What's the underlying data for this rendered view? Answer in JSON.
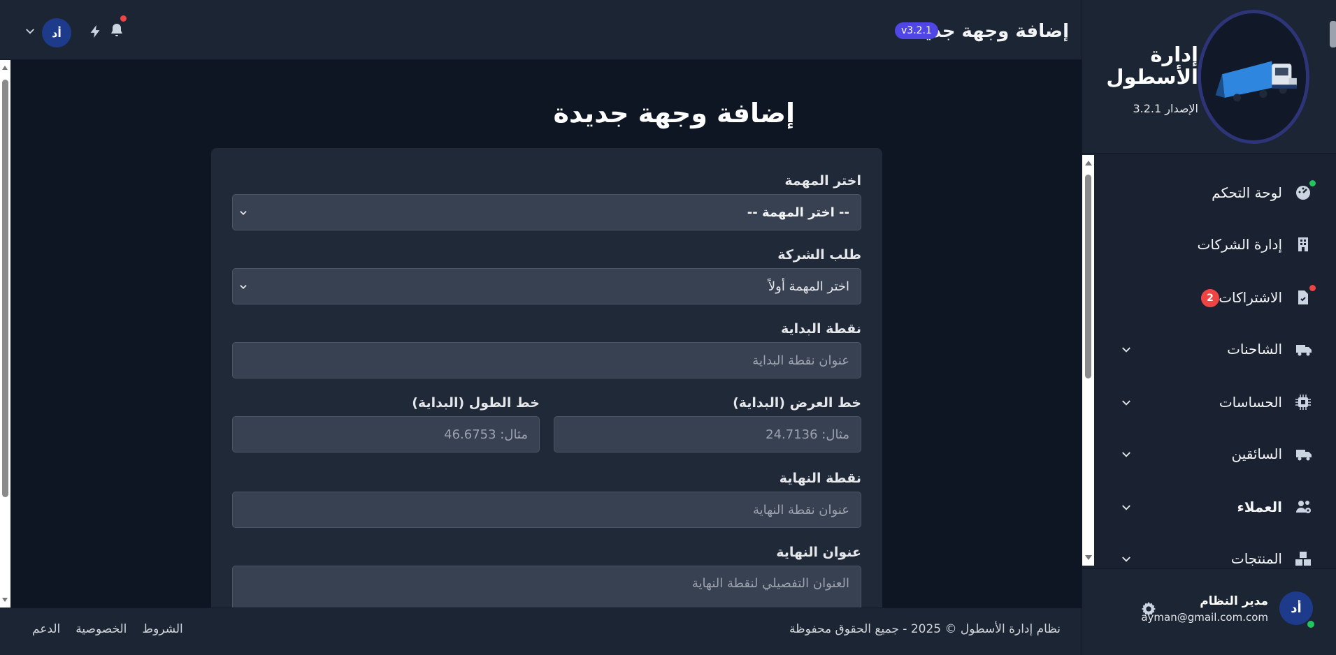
{
  "topbar": {
    "title": "إضافة وجهة جديدة",
    "version_badge": "v3.2.1",
    "avatar_initials": "أد"
  },
  "page": {
    "title": "إضافة وجهة جديدة"
  },
  "form": {
    "task_label": "اختر المهمة",
    "task_value": "-- اختر المهمة --",
    "company_request_label": "طلب الشركة",
    "company_request_value": "اختر المهمة أولاً",
    "start_point_label": "نقطة البداية",
    "start_point_placeholder": "عنوان نقطة البداية",
    "start_lat_label": "خط العرض (البداية)",
    "start_lat_placeholder": "مثال: 24.7136",
    "start_lng_label": "خط الطول (البداية)",
    "start_lng_placeholder": "مثال: 46.6753",
    "end_point_label": "نقطة النهاية",
    "end_point_placeholder": "عنوان نقطة النهاية",
    "end_address_label": "عنوان النهاية",
    "end_address_placeholder": "العنوان التفصيلي لنقطة النهاية"
  },
  "footer": {
    "copyright": "نظام إدارة الأسطول © 2025 - جميع الحقوق محفوظة",
    "links": [
      "الشروط",
      "الخصوصية",
      "الدعم"
    ]
  },
  "sidebar": {
    "brand_title": "إدارة الأسطول",
    "brand_version": "الإصدار 3.2.1",
    "items": [
      {
        "label": "لوحة التحكم",
        "icon": "gauge-icon"
      },
      {
        "label": "إدارة الشركات",
        "icon": "building-icon"
      },
      {
        "label": "الاشتراكات",
        "icon": "document-icon",
        "badge": "2"
      },
      {
        "label": "الشاحنات",
        "icon": "truck-icon"
      },
      {
        "label": "الحساسات",
        "icon": "chip-icon"
      },
      {
        "label": "السائقين",
        "icon": "truck-icon"
      },
      {
        "label": "العملاء",
        "icon": "users-cog-icon"
      },
      {
        "label": "المنتجات",
        "icon": "boxes-icon"
      }
    ]
  },
  "user": {
    "initials": "أد",
    "name": "مدير النظام",
    "email": "ayman@gmail.com.com"
  },
  "colors": {
    "background": "#0f1623",
    "panel": "#1c2533",
    "card": "#1f2937",
    "input": "#374151",
    "accent": "#4f46e5",
    "badge": "#ef4444",
    "online": "#22c55e"
  }
}
